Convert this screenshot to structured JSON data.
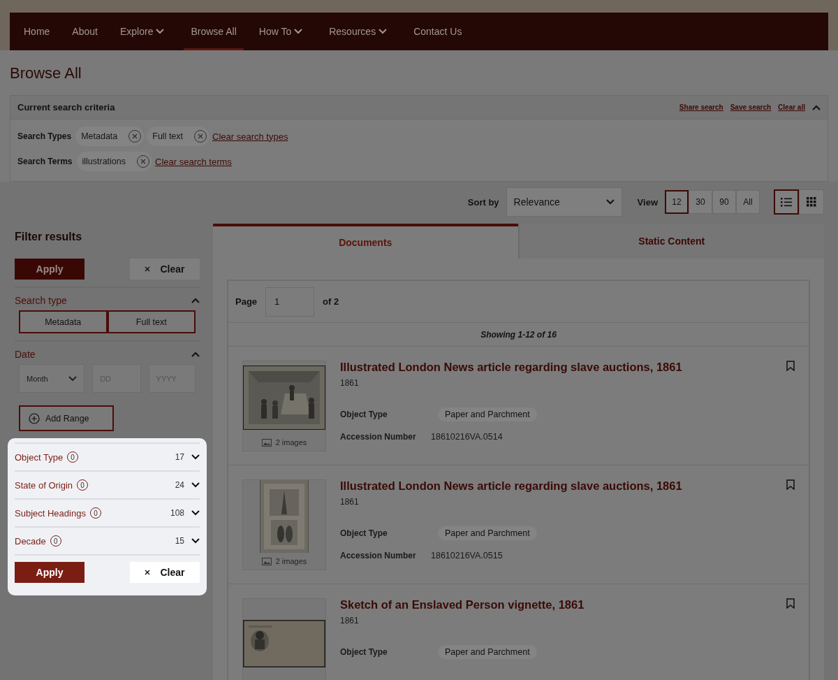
{
  "nav": {
    "items": [
      {
        "label": "Home",
        "dropdown": false,
        "selected": false
      },
      {
        "label": "About",
        "dropdown": false,
        "selected": false
      },
      {
        "label": "Explore",
        "dropdown": true,
        "selected": false
      },
      {
        "label": "Browse All",
        "dropdown": false,
        "selected": true
      },
      {
        "label": "How To",
        "dropdown": true,
        "selected": false
      },
      {
        "label": "Resources",
        "dropdown": true,
        "selected": false
      },
      {
        "label": "Contact Us",
        "dropdown": false,
        "selected": false
      }
    ]
  },
  "page_title": "Browse All",
  "criteria": {
    "title": "Current search criteria",
    "expanded": true,
    "actions": [
      "Share search",
      "Save search",
      "Clear all"
    ],
    "rows": [
      {
        "label": "Search Types",
        "chips": [
          "Metadata",
          "Full text"
        ],
        "clear_link": "Clear search types"
      },
      {
        "label": "Search Terms",
        "chips": [
          "illustrations"
        ],
        "clear_link": "Clear search terms"
      }
    ]
  },
  "toolbar": {
    "sort_label": "Sort by",
    "sort_value": "Relevance",
    "view_label": "View",
    "view_options": [
      {
        "label": "12",
        "selected": true
      },
      {
        "label": "30",
        "selected": false
      },
      {
        "label": "90",
        "selected": false
      },
      {
        "label": "All",
        "selected": false
      }
    ],
    "layouts": [
      {
        "kind": "list",
        "selected": true
      },
      {
        "kind": "grid",
        "selected": false
      }
    ]
  },
  "filters": {
    "title": "Filter results",
    "apply": "Apply",
    "clear": "Clear",
    "search_type": {
      "title": "Search type",
      "expanded": true,
      "options": [
        {
          "label": "Metadata",
          "selected": true
        },
        {
          "label": "Full text",
          "selected": true
        }
      ]
    },
    "date": {
      "title": "Date",
      "expanded": true,
      "month": "Month",
      "day_placeholder": "DD",
      "year_placeholder": "YYYY",
      "add_range": "Add Range"
    },
    "facets": [
      {
        "label": "Object Type",
        "selected_count": "0",
        "count": "17",
        "expanded": false
      },
      {
        "label": "State of Origin",
        "selected_count": "0",
        "count": "24",
        "expanded": false
      },
      {
        "label": "Subject Headings",
        "selected_count": "0",
        "count": "108",
        "expanded": false
      },
      {
        "label": "Decade",
        "selected_count": "0",
        "count": "15",
        "expanded": false
      }
    ],
    "apply_bottom": "Apply",
    "clear_bottom": "Clear"
  },
  "tabs": [
    {
      "label": "Documents",
      "selected": true
    },
    {
      "label": "Static Content",
      "selected": false
    }
  ],
  "pagination": {
    "label": "Page",
    "value": "1",
    "of": "of 2"
  },
  "showing": "Showing 1-12 of 16",
  "results": [
    {
      "title": "Illustrated London News article regarding slave auctions, 1861",
      "date": "1861",
      "images": "2 images",
      "fields": [
        {
          "label": "Object Type",
          "value": "Paper and Parchment",
          "kind": "tag"
        },
        {
          "label": "Accession Number",
          "value": "18610216VA.0514",
          "kind": "text"
        }
      ]
    },
    {
      "title": "Illustrated London News article regarding slave auctions, 1861",
      "date": "1861",
      "images": "2 images",
      "fields": [
        {
          "label": "Object Type",
          "value": "Paper and Parchment",
          "kind": "tag"
        },
        {
          "label": "Accession Number",
          "value": "18610216VA.0515",
          "kind": "text"
        }
      ]
    },
    {
      "title": "Sketch of an Enslaved Person vignette, 1861",
      "date": "1861",
      "fields": [
        {
          "label": "Object Type",
          "value": "Paper and Parchment",
          "kind": "tag"
        }
      ]
    }
  ]
}
